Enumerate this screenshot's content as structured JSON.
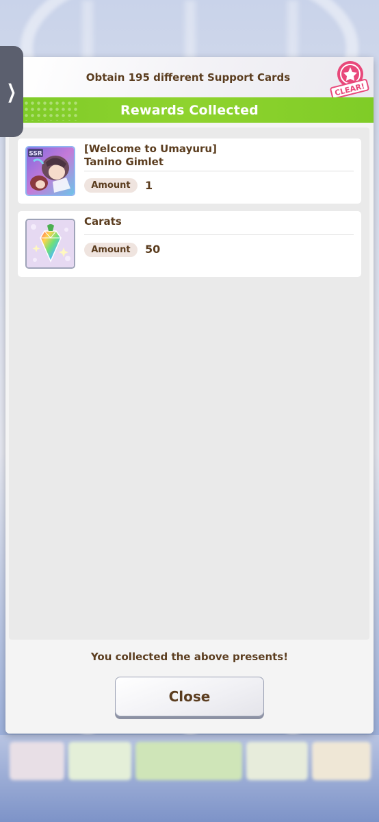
{
  "mission": {
    "text": "Obtain 195 different Support Cards",
    "stamp_label": "CLEAR!"
  },
  "header": {
    "title": "Rewards Collected"
  },
  "rewards": [
    {
      "title_line1": "[Welcome to Umayuru]",
      "title_line2": "Tanino Gimlet",
      "amount_label": "Amount",
      "amount": "1",
      "icon": "ssr-support-card-icon",
      "badge": "SSR"
    },
    {
      "title_line1": "Carats",
      "amount_label": "Amount",
      "amount": "50",
      "icon": "carat-crystal-icon"
    }
  ],
  "footer": {
    "message": "You collected the above presents!",
    "close_label": "Close"
  },
  "colors": {
    "header_green": "#8fd32e",
    "text_brown": "#5b3d1f",
    "stamp_pink": "#e8487a"
  }
}
